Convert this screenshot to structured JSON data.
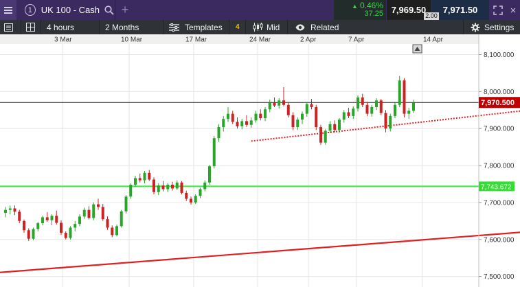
{
  "topbar": {
    "instrument_number": "1",
    "instrument_name": "UK 100 - Cash",
    "add_icon": "+",
    "change_pct": "0.46%",
    "change_pts": "37.25",
    "sell_price": "7,969.50",
    "buy_price": "7,971.50",
    "spread": "2.00",
    "close_icon": "×",
    "colors": {
      "bar": "#3b2a60",
      "positive": "#3fd24a"
    }
  },
  "toolbar": {
    "interval": "4 hours",
    "range": "2 Months",
    "templates_label": "Templates",
    "templates_count": "4",
    "price_type": "Mid",
    "related_label": "Related",
    "settings_label": "Settings"
  },
  "chart_data": {
    "type": "candlestick",
    "x_tick_labels": [
      "3 Mar",
      "10 Mar",
      "17 Mar",
      "24 Mar",
      "2 Apr",
      "7 Apr",
      "14 Apr"
    ],
    "y_tick_labels": [
      "8,100.000",
      "8,000.000",
      "7,900.000",
      "7,800.000",
      "7,700.000",
      "7,600.000",
      "7,500.000"
    ],
    "y_ticks": [
      8100,
      8000,
      7900,
      7800,
      7700,
      7600,
      7500
    ],
    "ylim": [
      7474,
      8164
    ],
    "current_price": {
      "value": 7970.5,
      "label": "7,970.500",
      "color": "#c00000"
    },
    "green_level": {
      "value": 7743.672,
      "label": "7,743.672",
      "color": "#33ee33"
    },
    "trendlines": [
      {
        "name": "solid-red-trendline",
        "style": "solid",
        "color": "#e02020",
        "start": [
          -2,
          7510
        ],
        "end": [
          120,
          7628
        ]
      },
      {
        "name": "dotted-red-trendline",
        "style": "dotted",
        "color": "#e02020",
        "start": [
          53,
          7866
        ],
        "end": [
          120,
          7960
        ]
      }
    ],
    "candles": [
      {
        "o": 7672,
        "h": 7688,
        "l": 7660,
        "c": 7680
      },
      {
        "o": 7680,
        "h": 7692,
        "l": 7668,
        "c": 7684
      },
      {
        "o": 7684,
        "h": 7692,
        "l": 7666,
        "c": 7675
      },
      {
        "o": 7675,
        "h": 7680,
        "l": 7644,
        "c": 7650
      },
      {
        "o": 7650,
        "h": 7654,
        "l": 7618,
        "c": 7625
      },
      {
        "o": 7625,
        "h": 7630,
        "l": 7596,
        "c": 7602
      },
      {
        "o": 7602,
        "h": 7632,
        "l": 7598,
        "c": 7628
      },
      {
        "o": 7628,
        "h": 7648,
        "l": 7622,
        "c": 7644
      },
      {
        "o": 7644,
        "h": 7664,
        "l": 7638,
        "c": 7660
      },
      {
        "o": 7660,
        "h": 7674,
        "l": 7648,
        "c": 7652
      },
      {
        "o": 7652,
        "h": 7668,
        "l": 7638,
        "c": 7664
      },
      {
        "o": 7664,
        "h": 7678,
        "l": 7640,
        "c": 7645
      },
      {
        "o": 7645,
        "h": 7652,
        "l": 7612,
        "c": 7618
      },
      {
        "o": 7618,
        "h": 7622,
        "l": 7600,
        "c": 7604
      },
      {
        "o": 7604,
        "h": 7636,
        "l": 7600,
        "c": 7632
      },
      {
        "o": 7632,
        "h": 7650,
        "l": 7622,
        "c": 7642
      },
      {
        "o": 7642,
        "h": 7668,
        "l": 7636,
        "c": 7662
      },
      {
        "o": 7662,
        "h": 7686,
        "l": 7656,
        "c": 7680
      },
      {
        "o": 7680,
        "h": 7690,
        "l": 7654,
        "c": 7658
      },
      {
        "o": 7658,
        "h": 7700,
        "l": 7652,
        "c": 7695
      },
      {
        "o": 7695,
        "h": 7710,
        "l": 7680,
        "c": 7688
      },
      {
        "o": 7688,
        "h": 7696,
        "l": 7650,
        "c": 7655
      },
      {
        "o": 7655,
        "h": 7662,
        "l": 7626,
        "c": 7632
      },
      {
        "o": 7632,
        "h": 7638,
        "l": 7606,
        "c": 7612
      },
      {
        "o": 7612,
        "h": 7640,
        "l": 7608,
        "c": 7636
      },
      {
        "o": 7636,
        "h": 7680,
        "l": 7632,
        "c": 7676
      },
      {
        "o": 7676,
        "h": 7720,
        "l": 7670,
        "c": 7716
      },
      {
        "o": 7716,
        "h": 7752,
        "l": 7710,
        "c": 7748
      },
      {
        "o": 7748,
        "h": 7772,
        "l": 7742,
        "c": 7766
      },
      {
        "o": 7766,
        "h": 7778,
        "l": 7754,
        "c": 7760
      },
      {
        "o": 7760,
        "h": 7785,
        "l": 7752,
        "c": 7780
      },
      {
        "o": 7780,
        "h": 7788,
        "l": 7758,
        "c": 7762
      },
      {
        "o": 7762,
        "h": 7768,
        "l": 7722,
        "c": 7728
      },
      {
        "o": 7728,
        "h": 7752,
        "l": 7720,
        "c": 7746
      },
      {
        "o": 7746,
        "h": 7758,
        "l": 7730,
        "c": 7736
      },
      {
        "o": 7736,
        "h": 7752,
        "l": 7728,
        "c": 7748
      },
      {
        "o": 7748,
        "h": 7756,
        "l": 7732,
        "c": 7738
      },
      {
        "o": 7738,
        "h": 7760,
        "l": 7734,
        "c": 7754
      },
      {
        "o": 7754,
        "h": 7758,
        "l": 7722,
        "c": 7726
      },
      {
        "o": 7726,
        "h": 7732,
        "l": 7704,
        "c": 7710
      },
      {
        "o": 7710,
        "h": 7716,
        "l": 7694,
        "c": 7700
      },
      {
        "o": 7700,
        "h": 7722,
        "l": 7696,
        "c": 7718
      },
      {
        "o": 7718,
        "h": 7740,
        "l": 7712,
        "c": 7736
      },
      {
        "o": 7736,
        "h": 7760,
        "l": 7730,
        "c": 7754
      },
      {
        "o": 7754,
        "h": 7802,
        "l": 7748,
        "c": 7798
      },
      {
        "o": 7798,
        "h": 7880,
        "l": 7792,
        "c": 7874
      },
      {
        "o": 7874,
        "h": 7912,
        "l": 7864,
        "c": 7904
      },
      {
        "o": 7904,
        "h": 7934,
        "l": 7892,
        "c": 7926
      },
      {
        "o": 7926,
        "h": 7958,
        "l": 7918,
        "c": 7940
      },
      {
        "o": 7940,
        "h": 7948,
        "l": 7912,
        "c": 7918
      },
      {
        "o": 7918,
        "h": 7930,
        "l": 7900,
        "c": 7906
      },
      {
        "o": 7906,
        "h": 7926,
        "l": 7898,
        "c": 7920
      },
      {
        "o": 7920,
        "h": 7936,
        "l": 7904,
        "c": 7910
      },
      {
        "o": 7910,
        "h": 7930,
        "l": 7902,
        "c": 7922
      },
      {
        "o": 7922,
        "h": 7948,
        "l": 7916,
        "c": 7940
      },
      {
        "o": 7940,
        "h": 7952,
        "l": 7922,
        "c": 7928
      },
      {
        "o": 7928,
        "h": 7958,
        "l": 7920,
        "c": 7952
      },
      {
        "o": 7952,
        "h": 7978,
        "l": 7944,
        "c": 7970
      },
      {
        "o": 7970,
        "h": 7984,
        "l": 7958,
        "c": 7962
      },
      {
        "o": 7962,
        "h": 7982,
        "l": 7954,
        "c": 7976
      },
      {
        "o": 7976,
        "h": 8012,
        "l": 7960,
        "c": 7964
      },
      {
        "o": 7964,
        "h": 7972,
        "l": 7930,
        "c": 7936
      },
      {
        "o": 7936,
        "h": 7944,
        "l": 7896,
        "c": 7904
      },
      {
        "o": 7904,
        "h": 7930,
        "l": 7896,
        "c": 7924
      },
      {
        "o": 7924,
        "h": 7946,
        "l": 7912,
        "c": 7940
      },
      {
        "o": 7940,
        "h": 7972,
        "l": 7932,
        "c": 7966
      },
      {
        "o": 7966,
        "h": 7980,
        "l": 7952,
        "c": 7958
      },
      {
        "o": 7958,
        "h": 7964,
        "l": 7896,
        "c": 7904
      },
      {
        "o": 7904,
        "h": 7910,
        "l": 7856,
        "c": 7862
      },
      {
        "o": 7862,
        "h": 7898,
        "l": 7856,
        "c": 7894
      },
      {
        "o": 7894,
        "h": 7920,
        "l": 7888,
        "c": 7912
      },
      {
        "o": 7912,
        "h": 7922,
        "l": 7890,
        "c": 7896
      },
      {
        "o": 7896,
        "h": 7928,
        "l": 7888,
        "c": 7924
      },
      {
        "o": 7924,
        "h": 7950,
        "l": 7916,
        "c": 7944
      },
      {
        "o": 7944,
        "h": 7956,
        "l": 7928,
        "c": 7934
      },
      {
        "o": 7934,
        "h": 7960,
        "l": 7926,
        "c": 7954
      },
      {
        "o": 7954,
        "h": 7990,
        "l": 7946,
        "c": 7984
      },
      {
        "o": 7984,
        "h": 7994,
        "l": 7958,
        "c": 7964
      },
      {
        "o": 7964,
        "h": 7972,
        "l": 7934,
        "c": 7940
      },
      {
        "o": 7940,
        "h": 7964,
        "l": 7932,
        "c": 7958
      },
      {
        "o": 7958,
        "h": 7982,
        "l": 7950,
        "c": 7976
      },
      {
        "o": 7976,
        "h": 7980,
        "l": 7936,
        "c": 7942
      },
      {
        "o": 7942,
        "h": 7950,
        "l": 7890,
        "c": 7900
      },
      {
        "o": 7900,
        "h": 7940,
        "l": 7892,
        "c": 7934
      },
      {
        "o": 7934,
        "h": 7970,
        "l": 7928,
        "c": 7964
      },
      {
        "o": 7964,
        "h": 8042,
        "l": 7958,
        "c": 8030
      },
      {
        "o": 8030,
        "h": 8036,
        "l": 7930,
        "c": 7940
      },
      {
        "o": 7940,
        "h": 7956,
        "l": 7926,
        "c": 7948
      },
      {
        "o": 7948,
        "h": 7978,
        "l": 7942,
        "c": 7970
      }
    ],
    "grid": true,
    "legend": "none"
  }
}
